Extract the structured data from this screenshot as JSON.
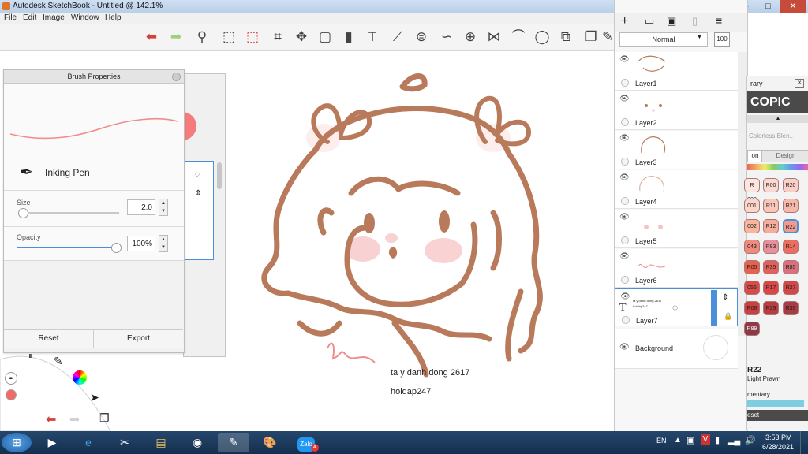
{
  "window": {
    "title": "Autodesk SketchBook - Untitled @ 142.1%",
    "minimize": "–",
    "maximize": "□",
    "close": "✕"
  },
  "menu": [
    "File",
    "Edit",
    "Image",
    "Window",
    "Help"
  ],
  "toolbar": {
    "icons": [
      "undo-icon",
      "redo-icon",
      "zoom-icon",
      "select-icon",
      "crop-lasso-icon",
      "crop-icon",
      "transform-icon",
      "distort-icon",
      "fill-icon",
      "text-icon",
      "ruler-icon",
      "ellipse-guide-icon",
      "french-curve-icon",
      "perspective-icon",
      "symmetry-icon",
      "stroke-icon",
      "circle-icon",
      "shape-icon",
      "copy-icon",
      "brush-icon"
    ]
  },
  "brush_properties": {
    "title": "Brush Properties",
    "brush_name": "Inking Pen",
    "size_label": "Size",
    "size_value": "2.0",
    "size_fraction": 0.02,
    "opacity_label": "Opacity",
    "opacity_value": "100%",
    "opacity_fraction": 1.0,
    "reset_label": "Reset",
    "export_label": "Export",
    "stroke_color": "#f08c8c"
  },
  "layers": {
    "blend_mode": "Normal",
    "opacity_value": "100",
    "items": [
      {
        "name": "Layer1"
      },
      {
        "name": "Layer2"
      },
      {
        "name": "Layer3"
      },
      {
        "name": "Layer4"
      },
      {
        "name": "Layer5"
      },
      {
        "name": "Layer6"
      },
      {
        "name": "Layer7",
        "selected": true,
        "type": "text",
        "thumb_text_1": "ta y danh dong 2617",
        "thumb_text_2": "hoidap247"
      },
      {
        "name": "Background"
      }
    ]
  },
  "copic": {
    "library_label": "rary",
    "brand": "COPIC",
    "set_label": "Colorless Blen..",
    "tabs": [
      "on",
      "Design"
    ],
    "swatches": [
      [
        "R 000",
        "R00",
        "R20"
      ],
      [
        "001",
        "R11",
        "R21"
      ],
      [
        "002",
        "R12",
        "R22"
      ],
      [
        "043",
        "R83",
        "R14"
      ],
      [
        "R05",
        "R35",
        "R85"
      ],
      [
        "056",
        "R17",
        "R27"
      ],
      [
        "R08",
        "R29",
        "R39"
      ],
      [
        "R89"
      ]
    ],
    "selected_code": "R22",
    "selected_name": "Light Prawn",
    "selected_desc": "mentary",
    "reset_label": "eset"
  },
  "canvas": {
    "signature_text": "llever",
    "line1": "ta y danh dong 2617",
    "line2": "hoidap247",
    "stroke_color": "#b87a5a",
    "blush_color": "#f5b5b5"
  },
  "taskbar": {
    "lang": "EN",
    "time": "3:53 PM",
    "date": "6/28/2021",
    "notification_count": "4"
  }
}
